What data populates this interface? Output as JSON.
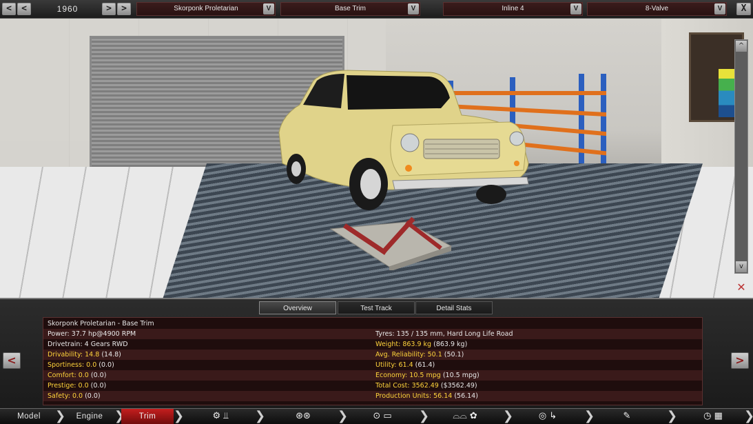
{
  "topbar": {
    "year": "1960",
    "prev_label": "<",
    "prev2_label": "<",
    "next_label": ">",
    "next2_label": ">",
    "model": "Skorponk Proletarian",
    "trim": "Base Trim",
    "engine": "Inline 4",
    "valve": "8-Valve",
    "dropdown_arrow": "V",
    "close_label": "X"
  },
  "scene": {
    "scroll_up": "^",
    "scroll_down": "v"
  },
  "tabs": [
    {
      "label": "Overview",
      "active": true
    },
    {
      "label": "Test Track",
      "active": false
    },
    {
      "label": "Detail Stats",
      "active": false
    }
  ],
  "stats": {
    "title": "Skorponk Proletarian - Base Trim",
    "left": [
      {
        "label": "Power:",
        "value": "37.7 hp@4900 RPM",
        "highlight": false
      },
      {
        "label": "Drivetrain:",
        "value": "4 Gears RWD",
        "highlight": false
      },
      {
        "label": "Drivability:",
        "value": "14.8",
        "extra": "(14.8)",
        "highlight": true
      },
      {
        "label": "Sportiness:",
        "value": "0.0",
        "extra": "(0.0)",
        "highlight": true
      },
      {
        "label": "Comfort:",
        "value": "0.0",
        "extra": "(0.0)",
        "highlight": true
      },
      {
        "label": "Prestige:",
        "value": "0.0",
        "extra": "(0.0)",
        "highlight": true
      },
      {
        "label": "Safety:",
        "value": "0.0",
        "extra": "(0.0)",
        "highlight": true
      }
    ],
    "right": [
      {
        "label": "Tyres:",
        "value": "135 / 135 mm, Hard Long Life Road",
        "highlight": false
      },
      {
        "label": "Weight:",
        "value": "863.9 kg",
        "extra": "(863.9 kg)",
        "highlight": true
      },
      {
        "label": "Avg. Reliability:",
        "value": "50.1",
        "extra": "(50.1)",
        "highlight": true
      },
      {
        "label": "Utility:",
        "value": "61.4",
        "extra": "(61.4)",
        "highlight": true
      },
      {
        "label": "Economy:",
        "value": "10.5 mpg",
        "extra": "(10.5 mpg)",
        "highlight": true
      },
      {
        "label": "Total Cost:",
        "value": "3562.49",
        "extra": "($3562.49)",
        "highlight": true
      },
      {
        "label": "Production Units:",
        "value": "56.14",
        "extra": "(56.14)",
        "highlight": true
      }
    ],
    "nav_prev": "<",
    "nav_next": ">"
  },
  "bottomnav": {
    "model": "Model",
    "engine": "Engine",
    "trim": "Trim"
  }
}
